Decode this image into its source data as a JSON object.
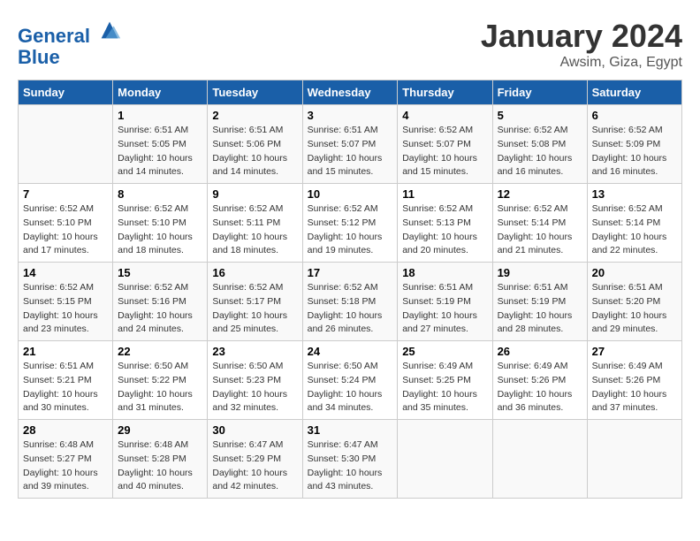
{
  "header": {
    "logo_line1": "General",
    "logo_line2": "Blue",
    "month": "January 2024",
    "location": "Awsim, Giza, Egypt"
  },
  "weekdays": [
    "Sunday",
    "Monday",
    "Tuesday",
    "Wednesday",
    "Thursday",
    "Friday",
    "Saturday"
  ],
  "weeks": [
    [
      {
        "day": "",
        "sunrise": "",
        "sunset": "",
        "daylight": ""
      },
      {
        "day": "1",
        "sunrise": "Sunrise: 6:51 AM",
        "sunset": "Sunset: 5:05 PM",
        "daylight": "Daylight: 10 hours and 14 minutes."
      },
      {
        "day": "2",
        "sunrise": "Sunrise: 6:51 AM",
        "sunset": "Sunset: 5:06 PM",
        "daylight": "Daylight: 10 hours and 14 minutes."
      },
      {
        "day": "3",
        "sunrise": "Sunrise: 6:51 AM",
        "sunset": "Sunset: 5:07 PM",
        "daylight": "Daylight: 10 hours and 15 minutes."
      },
      {
        "day": "4",
        "sunrise": "Sunrise: 6:52 AM",
        "sunset": "Sunset: 5:07 PM",
        "daylight": "Daylight: 10 hours and 15 minutes."
      },
      {
        "day": "5",
        "sunrise": "Sunrise: 6:52 AM",
        "sunset": "Sunset: 5:08 PM",
        "daylight": "Daylight: 10 hours and 16 minutes."
      },
      {
        "day": "6",
        "sunrise": "Sunrise: 6:52 AM",
        "sunset": "Sunset: 5:09 PM",
        "daylight": "Daylight: 10 hours and 16 minutes."
      }
    ],
    [
      {
        "day": "7",
        "sunrise": "Sunrise: 6:52 AM",
        "sunset": "Sunset: 5:10 PM",
        "daylight": "Daylight: 10 hours and 17 minutes."
      },
      {
        "day": "8",
        "sunrise": "Sunrise: 6:52 AM",
        "sunset": "Sunset: 5:10 PM",
        "daylight": "Daylight: 10 hours and 18 minutes."
      },
      {
        "day": "9",
        "sunrise": "Sunrise: 6:52 AM",
        "sunset": "Sunset: 5:11 PM",
        "daylight": "Daylight: 10 hours and 18 minutes."
      },
      {
        "day": "10",
        "sunrise": "Sunrise: 6:52 AM",
        "sunset": "Sunset: 5:12 PM",
        "daylight": "Daylight: 10 hours and 19 minutes."
      },
      {
        "day": "11",
        "sunrise": "Sunrise: 6:52 AM",
        "sunset": "Sunset: 5:13 PM",
        "daylight": "Daylight: 10 hours and 20 minutes."
      },
      {
        "day": "12",
        "sunrise": "Sunrise: 6:52 AM",
        "sunset": "Sunset: 5:14 PM",
        "daylight": "Daylight: 10 hours and 21 minutes."
      },
      {
        "day": "13",
        "sunrise": "Sunrise: 6:52 AM",
        "sunset": "Sunset: 5:14 PM",
        "daylight": "Daylight: 10 hours and 22 minutes."
      }
    ],
    [
      {
        "day": "14",
        "sunrise": "Sunrise: 6:52 AM",
        "sunset": "Sunset: 5:15 PM",
        "daylight": "Daylight: 10 hours and 23 minutes."
      },
      {
        "day": "15",
        "sunrise": "Sunrise: 6:52 AM",
        "sunset": "Sunset: 5:16 PM",
        "daylight": "Daylight: 10 hours and 24 minutes."
      },
      {
        "day": "16",
        "sunrise": "Sunrise: 6:52 AM",
        "sunset": "Sunset: 5:17 PM",
        "daylight": "Daylight: 10 hours and 25 minutes."
      },
      {
        "day": "17",
        "sunrise": "Sunrise: 6:52 AM",
        "sunset": "Sunset: 5:18 PM",
        "daylight": "Daylight: 10 hours and 26 minutes."
      },
      {
        "day": "18",
        "sunrise": "Sunrise: 6:51 AM",
        "sunset": "Sunset: 5:19 PM",
        "daylight": "Daylight: 10 hours and 27 minutes."
      },
      {
        "day": "19",
        "sunrise": "Sunrise: 6:51 AM",
        "sunset": "Sunset: 5:19 PM",
        "daylight": "Daylight: 10 hours and 28 minutes."
      },
      {
        "day": "20",
        "sunrise": "Sunrise: 6:51 AM",
        "sunset": "Sunset: 5:20 PM",
        "daylight": "Daylight: 10 hours and 29 minutes."
      }
    ],
    [
      {
        "day": "21",
        "sunrise": "Sunrise: 6:51 AM",
        "sunset": "Sunset: 5:21 PM",
        "daylight": "Daylight: 10 hours and 30 minutes."
      },
      {
        "day": "22",
        "sunrise": "Sunrise: 6:50 AM",
        "sunset": "Sunset: 5:22 PM",
        "daylight": "Daylight: 10 hours and 31 minutes."
      },
      {
        "day": "23",
        "sunrise": "Sunrise: 6:50 AM",
        "sunset": "Sunset: 5:23 PM",
        "daylight": "Daylight: 10 hours and 32 minutes."
      },
      {
        "day": "24",
        "sunrise": "Sunrise: 6:50 AM",
        "sunset": "Sunset: 5:24 PM",
        "daylight": "Daylight: 10 hours and 34 minutes."
      },
      {
        "day": "25",
        "sunrise": "Sunrise: 6:49 AM",
        "sunset": "Sunset: 5:25 PM",
        "daylight": "Daylight: 10 hours and 35 minutes."
      },
      {
        "day": "26",
        "sunrise": "Sunrise: 6:49 AM",
        "sunset": "Sunset: 5:26 PM",
        "daylight": "Daylight: 10 hours and 36 minutes."
      },
      {
        "day": "27",
        "sunrise": "Sunrise: 6:49 AM",
        "sunset": "Sunset: 5:26 PM",
        "daylight": "Daylight: 10 hours and 37 minutes."
      }
    ],
    [
      {
        "day": "28",
        "sunrise": "Sunrise: 6:48 AM",
        "sunset": "Sunset: 5:27 PM",
        "daylight": "Daylight: 10 hours and 39 minutes."
      },
      {
        "day": "29",
        "sunrise": "Sunrise: 6:48 AM",
        "sunset": "Sunset: 5:28 PM",
        "daylight": "Daylight: 10 hours and 40 minutes."
      },
      {
        "day": "30",
        "sunrise": "Sunrise: 6:47 AM",
        "sunset": "Sunset: 5:29 PM",
        "daylight": "Daylight: 10 hours and 42 minutes."
      },
      {
        "day": "31",
        "sunrise": "Sunrise: 6:47 AM",
        "sunset": "Sunset: 5:30 PM",
        "daylight": "Daylight: 10 hours and 43 minutes."
      },
      {
        "day": "",
        "sunrise": "",
        "sunset": "",
        "daylight": ""
      },
      {
        "day": "",
        "sunrise": "",
        "sunset": "",
        "daylight": ""
      },
      {
        "day": "",
        "sunrise": "",
        "sunset": "",
        "daylight": ""
      }
    ]
  ]
}
